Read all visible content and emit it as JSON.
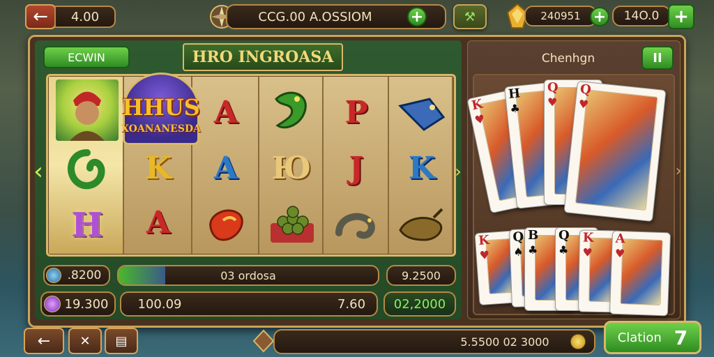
{
  "top_bar": {
    "back_value": "4.00",
    "center_label": "ССG.00 A.OSSIOM",
    "right_value_1": "240951",
    "right_value_2": "14O.0"
  },
  "slot_panel": {
    "left_button_label": "ECWIN",
    "title": "HRO INGROASA",
    "feature_symbol_title": "HHUS",
    "feature_symbol_subtitle": "XOANANESDA",
    "reel_letters": [
      [
        "",
        "A",
        "",
        "P",
        ""
      ],
      [
        "",
        "K",
        "A",
        "Ю",
        "J",
        "K"
      ],
      [
        "H",
        "A",
        "",
        "",
        "",
        ""
      ]
    ]
  },
  "bottom_stats": {
    "coin_value": ".8200",
    "gem_value": "19.300",
    "progress_label": "03 ordosa",
    "progress_fraction": 0.18,
    "bet_left": "100.09",
    "bet_right": "7.60",
    "win_top": "9.2500",
    "win_bottom": "02,2000"
  },
  "card_panel": {
    "title": "Chenhgn",
    "pause_label": "II",
    "top_cards": [
      {
        "rank": "K",
        "suit": "♥",
        "color": "#c0262b"
      },
      {
        "rank": "H",
        "suit": "♣",
        "color": "#111111"
      },
      {
        "rank": "Q",
        "suit": "♥",
        "color": "#c0262b"
      },
      {
        "rank": "Q",
        "suit": "♥",
        "color": "#c0262b"
      }
    ],
    "bottom_cards": [
      {
        "rank": "K",
        "suit": "♥",
        "color": "#c0262b"
      },
      {
        "rank": "Q",
        "suit": "♠",
        "color": "#111111"
      },
      {
        "rank": "B",
        "suit": "♣",
        "color": "#111111"
      },
      {
        "rank": "Q",
        "suit": "♣",
        "color": "#111111"
      },
      {
        "rank": "K",
        "suit": "♥",
        "color": "#c0262b"
      },
      {
        "rank": "A",
        "suit": "♥",
        "color": "#c0262b"
      }
    ]
  },
  "footer": {
    "total_value": "5.5500 02 3000",
    "action_label": "Clation",
    "action_count": "7"
  },
  "colors": {
    "felt": "#2d5a2e",
    "gold": "#c9a45a",
    "accent_green": "#4fb83a"
  }
}
